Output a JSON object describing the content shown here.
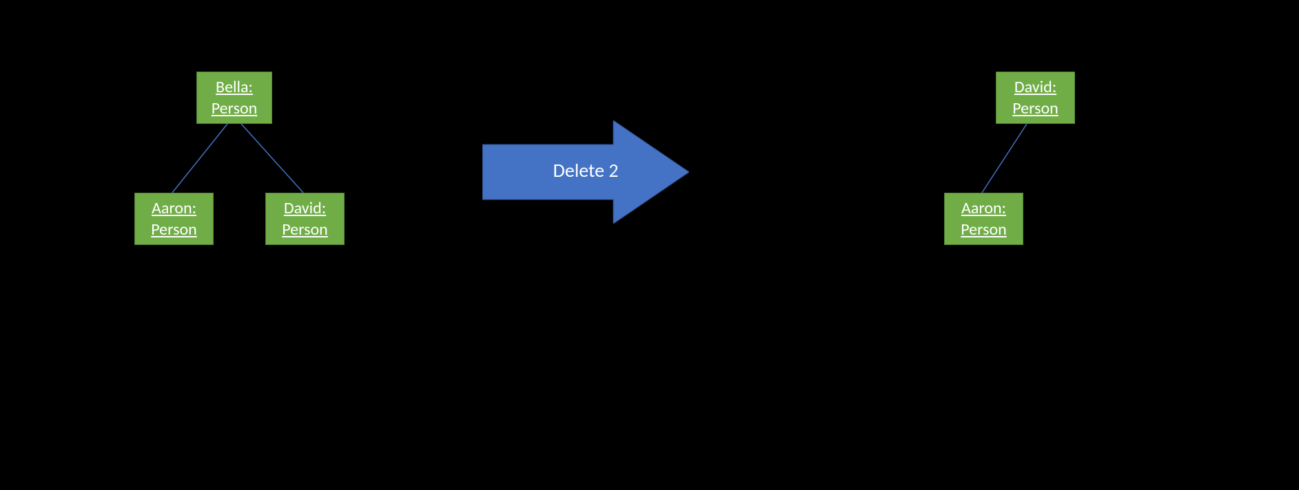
{
  "diagram": {
    "left_tree": {
      "root": {
        "name": "Bella:",
        "type": "Person"
      },
      "left_child": {
        "name": "Aaron:",
        "type": "Person"
      },
      "right_child": {
        "name": "David:",
        "type": "Person"
      }
    },
    "arrow": {
      "label": "Delete 2"
    },
    "right_tree": {
      "root": {
        "name": "David:",
        "type": "Person"
      },
      "left_child": {
        "name": "Aaron:",
        "type": "Person"
      }
    },
    "colors": {
      "node_fill": "#70AD47",
      "node_border": "#548235",
      "arrow_fill": "#4472C4",
      "line_color": "#4472C4",
      "text": "#FFFFFF",
      "background": "#000000"
    }
  }
}
